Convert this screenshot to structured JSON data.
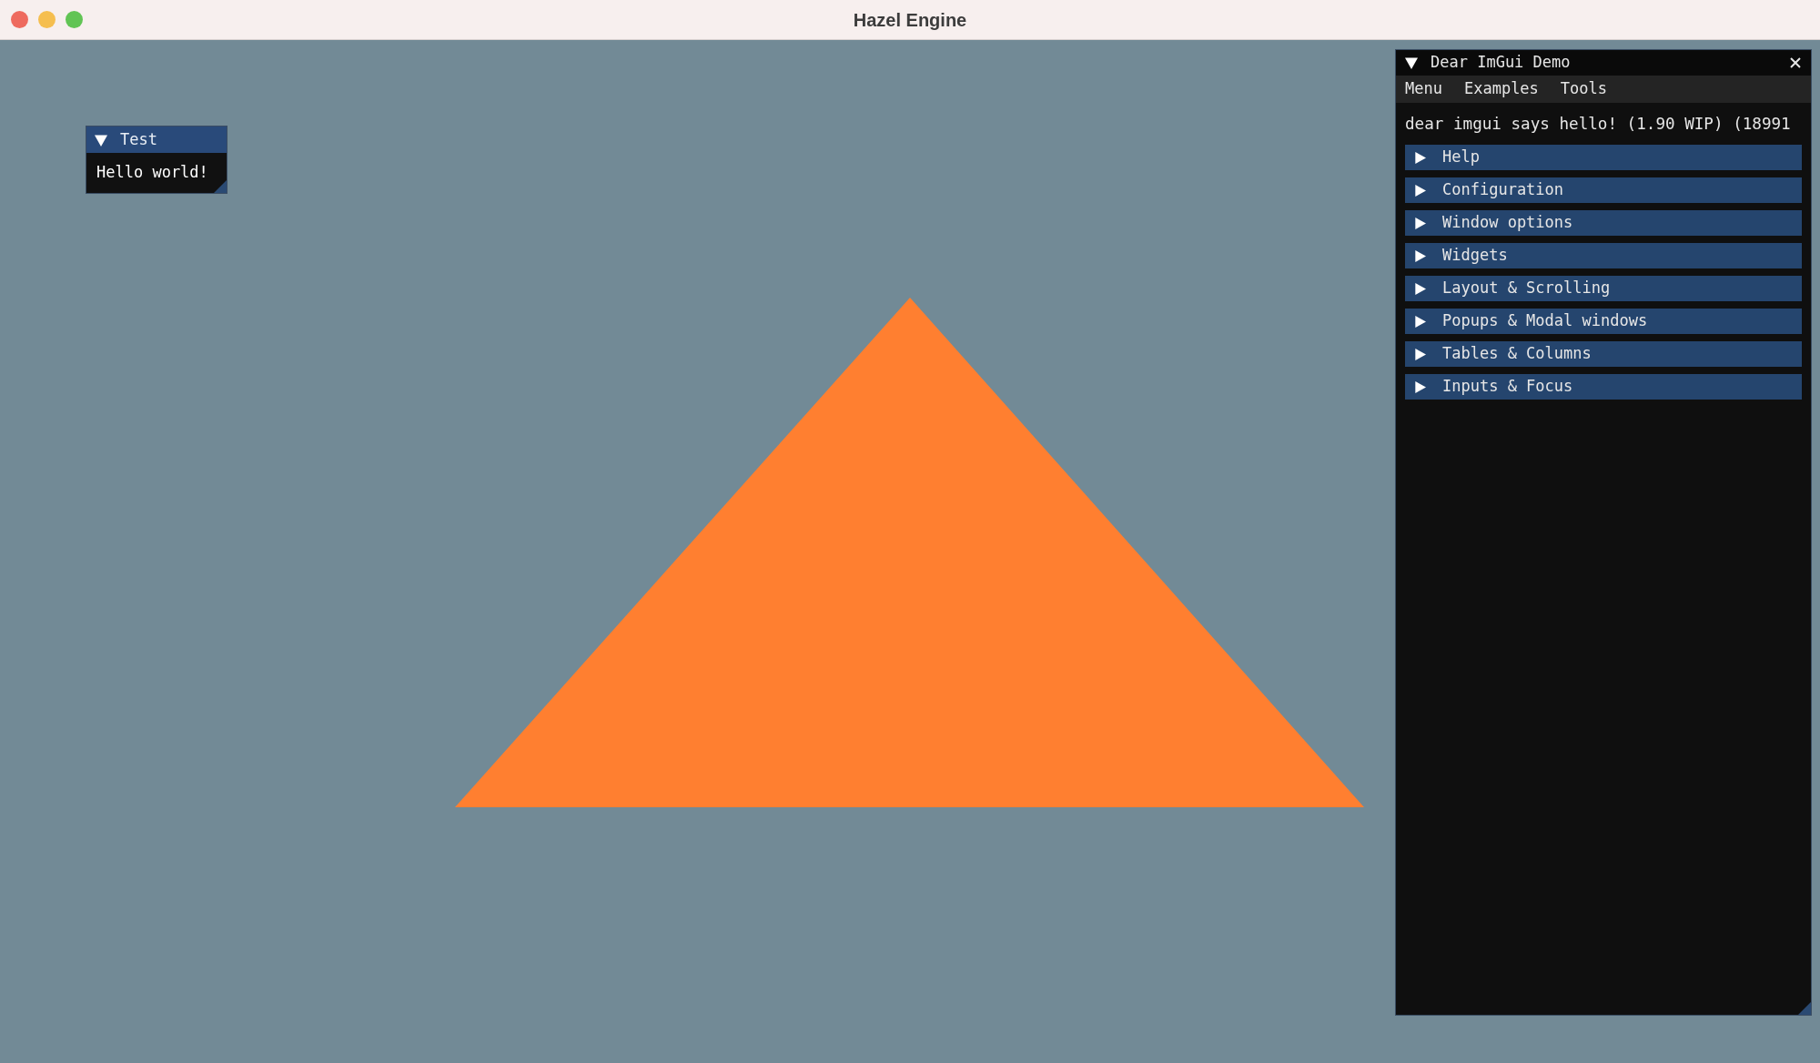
{
  "window": {
    "title": "Hazel Engine"
  },
  "test_window": {
    "title": "Test",
    "expanded": true,
    "text": "Hello world!"
  },
  "demo_window": {
    "title": "Dear ImGui Demo",
    "expanded": true,
    "menu": [
      "Menu",
      "Examples",
      "Tools"
    ],
    "text": "dear imgui says hello! (1.90 WIP) (18991",
    "headers": [
      {
        "label": "Help",
        "expanded": false
      },
      {
        "label": "Configuration",
        "expanded": false
      },
      {
        "label": "Window options",
        "expanded": false
      },
      {
        "label": "Widgets",
        "expanded": false
      },
      {
        "label": "Layout & Scrolling",
        "expanded": false
      },
      {
        "label": "Popups & Modal windows",
        "expanded": false
      },
      {
        "label": "Tables & Columns",
        "expanded": false
      },
      {
        "label": "Inputs & Focus",
        "expanded": false
      }
    ]
  }
}
